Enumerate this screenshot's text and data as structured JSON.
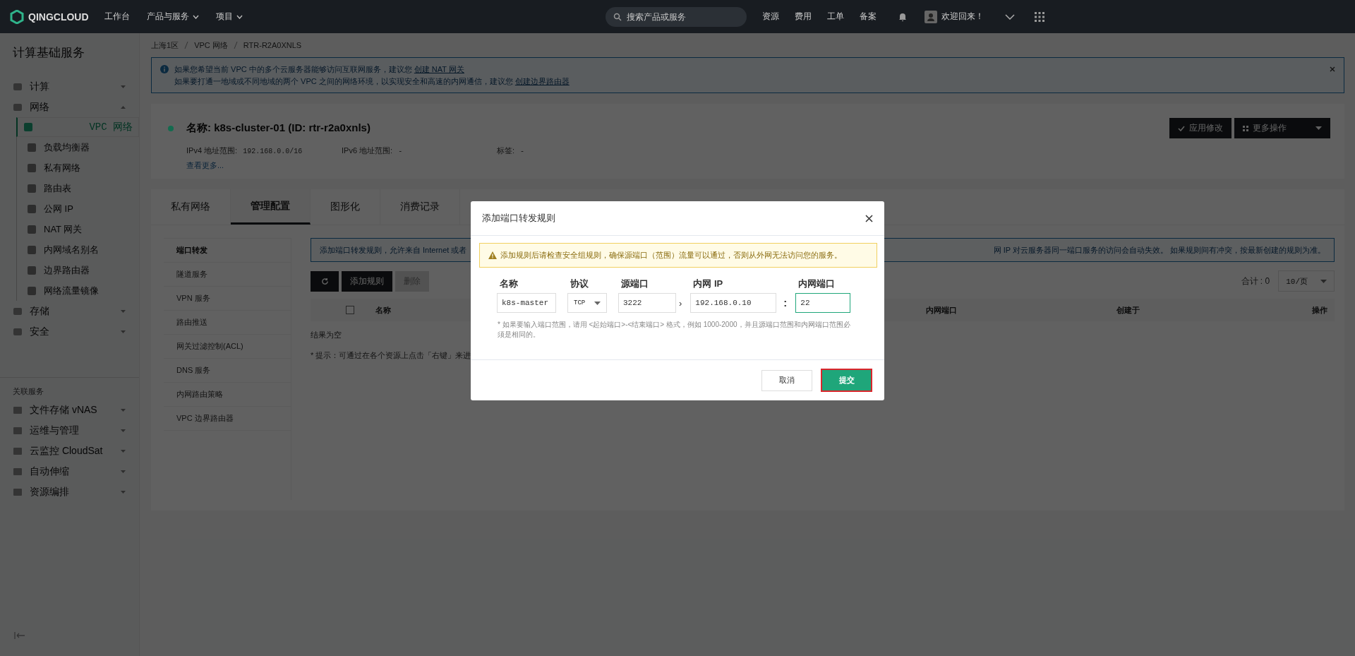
{
  "topbar": {
    "logo": "QINGCLOUD",
    "nav": [
      {
        "label": "工作台",
        "dropdown": false
      },
      {
        "label": "产品与服务",
        "dropdown": true
      },
      {
        "label": "项目",
        "dropdown": true
      }
    ],
    "search": {
      "placeholder": "搜索产品或服务"
    },
    "links": [
      "资源",
      "费用",
      "工单",
      "备案"
    ],
    "greeting": "欢迎回来！"
  },
  "sidebar": {
    "title": "计算基础服务",
    "items": [
      {
        "label": "计算",
        "expanded": false
      },
      {
        "label": "网络",
        "expanded": true,
        "children": [
          {
            "label": "VPC 网络",
            "selected": true
          },
          {
            "label": "负载均衡器",
            "selected": false
          },
          {
            "label": "私有网络",
            "selected": false
          },
          {
            "label": "路由表",
            "selected": false
          },
          {
            "label": "公网 IP",
            "selected": false
          },
          {
            "label": "NAT 网关",
            "selected": false
          },
          {
            "label": "内网域名别名",
            "selected": false
          },
          {
            "label": "边界路由器",
            "selected": false
          },
          {
            "label": "网络流量镜像",
            "selected": false
          }
        ]
      },
      {
        "label": "存储",
        "expanded": false
      },
      {
        "label": "安全",
        "expanded": false
      }
    ],
    "related_title": "关联服务",
    "related": [
      {
        "label": "文件存储 vNAS",
        "expanded": false
      },
      {
        "label": "运维与管理",
        "expanded": false
      },
      {
        "label": "云监控 CloudSat",
        "expanded": false
      },
      {
        "label": "自动伸缩",
        "expanded": false
      },
      {
        "label": "资源编排",
        "expanded": false
      }
    ]
  },
  "breadcrumb": [
    "上海1区",
    "VPC 网络",
    "RTR-R2A0XNLS"
  ],
  "notice": {
    "lines": [
      {
        "text": "如果您希望当前 VPC 中的多个云服务器能够访问互联网服务，建议您",
        "link": "创建 NAT 网关"
      },
      {
        "text": "如果要打通一地域或不同地域的两个 VPC 之间的网络环境，以实现安全和高速的内网通信，建议您",
        "link": "创建边界路由器"
      }
    ]
  },
  "resource": {
    "color": "#146b4f",
    "name": "名称: k8s-cluster-01 (ID: rtr-r2a0xnls)",
    "fields": [
      {
        "label": "IPv4 地址范围:",
        "value": "192.168.0.0/16"
      },
      {
        "label": "IPv6 地址范围:",
        "value": "-"
      },
      {
        "label": "标签:",
        "value": "-"
      }
    ],
    "more": "查看更多...",
    "buttons": [
      "应用修改",
      "更多操作"
    ]
  },
  "tabs": [
    {
      "label": "私有网络",
      "selected": false
    },
    {
      "label": "管理配置",
      "selected": true
    },
    {
      "label": "图形化",
      "selected": false
    },
    {
      "label": "消费记录",
      "selected": false
    }
  ],
  "subnav": [
    {
      "label": "端口转发",
      "selected": true
    },
    {
      "label": "隧道服务",
      "selected": false
    },
    {
      "label": "VPN 服务",
      "selected": false
    },
    {
      "label": "路由推送",
      "selected": false
    },
    {
      "label": "网关过滤控制(ACL)",
      "selected": false
    },
    {
      "label": "DNS 服务",
      "selected": false
    },
    {
      "label": "内网路由策略",
      "selected": false
    },
    {
      "label": "VPC 边界路由器",
      "selected": false
    }
  ],
  "rules": {
    "info_left": "添加端口转发规则，允许来自 Internet 或者",
    "info_right": "网 IP 对云服务器同一端口服务的访问会自动失效。 如果规则间有冲突，按最新创建的规则为准。",
    "toolbar": [
      {
        "label": "添加规则",
        "disabled": false
      },
      {
        "label": "删除",
        "disabled": true
      }
    ],
    "total": "合计 : 0",
    "page_size": "10/页",
    "select_all": {
      "checked": false
    },
    "columns": [
      "名称",
      "内网端口",
      "创建于",
      "操作"
    ],
    "empty": "结果为空",
    "tip": "* 提示：可通过在各个资源上点击「右键」来进"
  },
  "dialog": {
    "title": "添加端口转发规则",
    "warning": "添加规则后请检查安全组规则，确保源端口（范围）流量可以通过，否则从外网无法访问您的服务。",
    "fields": [
      {
        "label": "名称",
        "value": "k8s-master",
        "kind": "input"
      },
      {
        "label": "协议",
        "value": "TCP",
        "kind": "select"
      },
      {
        "label": "源端口",
        "value": "3222",
        "kind": "input"
      },
      {
        "label": "内网 IP",
        "value": "192.168.0.10",
        "kind": "input"
      },
      {
        "label": "内网端口",
        "value": "22",
        "kind": "input",
        "focused": true
      }
    ],
    "separators": [
      "›",
      ":"
    ],
    "hint": "* 如果要输入端口范围，请用 <起始端口>-<结束端口> 格式，例如 1000-2000，并且源端口范围和内网端口范围必须是相同的。",
    "cancel": "取消",
    "submit": "提交"
  }
}
